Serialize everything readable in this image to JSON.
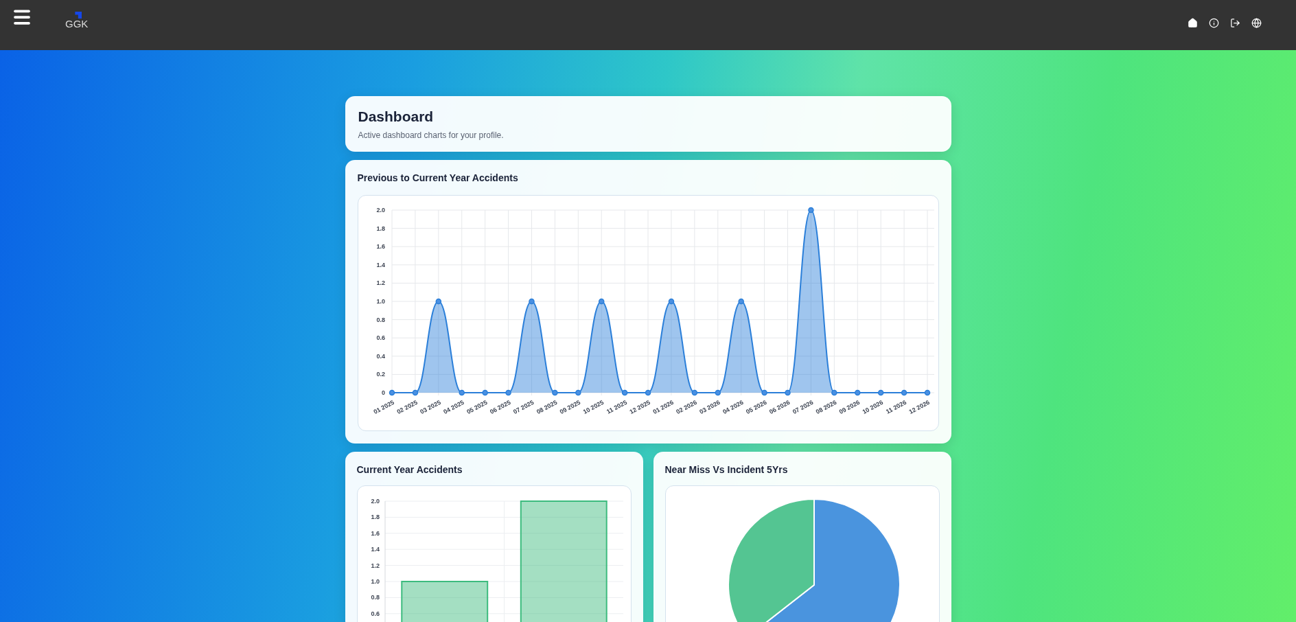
{
  "header": {
    "logo_text": "GGK"
  },
  "dashboard": {
    "title": "Dashboard",
    "subtitle": "Active dashboard charts for your profile."
  },
  "line_card": {
    "title": "Previous to Current Year Accidents",
    "chart_data": {
      "type": "area",
      "categories": [
        "01 2025",
        "02 2025",
        "03 2025",
        "04 2025",
        "05 2025",
        "06 2025",
        "07 2025",
        "08 2025",
        "09 2025",
        "10 2025",
        "11 2025",
        "12 2025",
        "01 2026",
        "02 2026",
        "03 2026",
        "04 2026",
        "05 2026",
        "06 2026",
        "07 2026",
        "08 2026",
        "09 2026",
        "10 2026",
        "11 2026",
        "12 2026"
      ],
      "series": [
        {
          "color": "#2b7fd9",
          "values": [
            0,
            0,
            1,
            0,
            0,
            0,
            1,
            0,
            0,
            1,
            0,
            0,
            1,
            0,
            0,
            1,
            0,
            0,
            2,
            0,
            0,
            0,
            0,
            0
          ]
        }
      ],
      "grid": true,
      "ylim": [
        0,
        2
      ],
      "yticks": [
        {
          "value": 0,
          "label": "0"
        },
        {
          "value": 0.2,
          "label": "0.2"
        },
        {
          "value": 0.4,
          "label": "0.4"
        },
        {
          "value": 0.6,
          "label": "0.6"
        },
        {
          "value": 0.8,
          "label": "0.8"
        },
        {
          "value": 1,
          "label": "1.0"
        },
        {
          "value": 1.2,
          "label": "1.2"
        },
        {
          "value": 1.4,
          "label": "1.4"
        },
        {
          "value": 1.6,
          "label": "1.6"
        },
        {
          "value": 1.8,
          "label": "1.8"
        },
        {
          "value": 2,
          "label": "2.0"
        }
      ]
    }
  },
  "bar_card": {
    "title": "Current Year Accidents",
    "chart_data": {
      "type": "bar",
      "series": [
        {
          "color": "#3dbb7e",
          "values": [
            1,
            2
          ]
        }
      ],
      "grid": true,
      "ylim": [
        0,
        2
      ],
      "yticks": [
        {
          "value": 0.6,
          "label": "0.6"
        },
        {
          "value": 0.8,
          "label": "0.8"
        },
        {
          "value": 1,
          "label": "1.0"
        },
        {
          "value": 1.2,
          "label": "1.2"
        },
        {
          "value": 1.4,
          "label": "1.4"
        },
        {
          "value": 1.6,
          "label": "1.6"
        },
        {
          "value": 1.8,
          "label": "1.8"
        },
        {
          "value": 2,
          "label": "2.0"
        }
      ]
    }
  },
  "pie_card": {
    "title": "Near Miss Vs Incident 5Yrs"
  }
}
